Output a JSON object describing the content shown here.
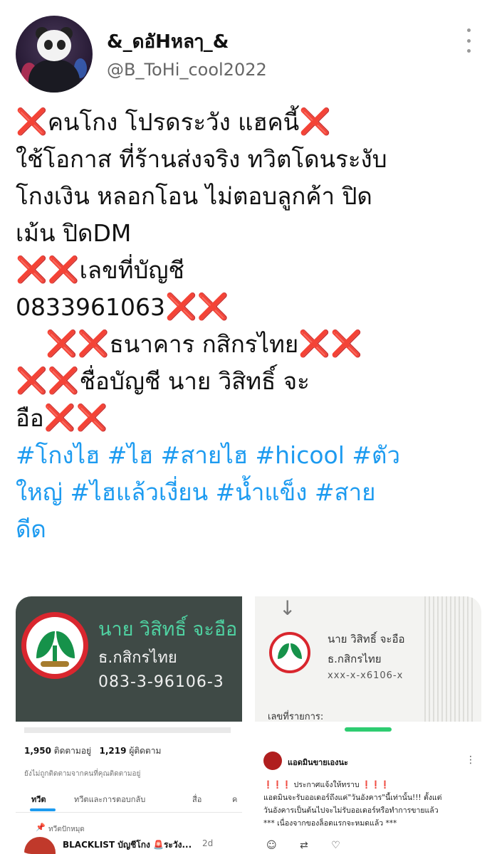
{
  "user": {
    "display_name": "&_ดอัHหลๅ_&",
    "handle": "@B_ToHi_cool2022"
  },
  "tweet": {
    "lines": [
      {
        "pre": "❌",
        "text": "คนโกง โปรดระวัง แฮคนี้",
        "post": "❌"
      },
      {
        "pre": "",
        "text": "ใช้โอกาส ที่ร้านส่งจริง ทวิตโดนระงับ",
        "post": ""
      },
      {
        "pre": "",
        "text": "โกงเงิน  หลอกโอน  ไม่ตอบลูกค้า ปิด",
        "post": ""
      },
      {
        "pre": "",
        "text": "เม้น ปิดDM",
        "post": ""
      },
      {
        "pre": "❌❌",
        "text": "เลขที่บัญชี",
        "post": ""
      },
      {
        "pre": "",
        "text": "0833961063",
        "post": "❌❌"
      },
      {
        "pre": "❌❌",
        "text": "ธนาคาร  กสิกรไทย",
        "post": "❌❌"
      },
      {
        "pre": "❌❌",
        "text": "ชื่อบัญชี  นาย วิสิทธิ์ จะ",
        "post": ""
      },
      {
        "pre": "",
        "text": "อือ",
        "post": "❌❌"
      }
    ],
    "hashtag_lines": [
      "#โกงไฮ #ไฮ #สายไฮ #hicool #ตัว",
      "ใหญ่ #ไฮแล้วเงี่ยน #น้ำแข็ง #สาย",
      "ดีด"
    ]
  },
  "media": {
    "card": {
      "name": "นาย วิสิทธิ์ จะอือ",
      "bank": "ธ.กสิกรไทย",
      "account": "083-3-96106-3"
    },
    "slip": {
      "arrow": "↓",
      "name": "นาย วิสิทธิ์ จะอือ",
      "bank": "ธ.กสิกรไทย",
      "account": "xxx-x-x6106-x",
      "ref_label": "เลขที่รายการ:"
    },
    "profile": {
      "following_count": "1,950",
      "following_label": "ติดตามอยู่",
      "followers_count": "1,219",
      "followers_label": "ผู้ติดตาม",
      "not_followed": "ยังไม่ถูกติดตามจากคนที่คุณติดตามอยู่",
      "tabs": [
        "ทวีต",
        "ทวีตและการตอบกลับ",
        "สื่อ",
        "ค"
      ],
      "pinned_label": "ทวีตปักหมุด",
      "pinned_title": "BLACKLIST บัญชีโกง 🚨ระวัง...",
      "pinned_time": "2d"
    },
    "admin_post": {
      "name": "แอดมินขายเองนะ",
      "line1_marks": "❗❗❗",
      "line1_text": "ประกาศแจ้งให้ทราบ",
      "line1_end": "❗❗❗",
      "line2": "แอดมินจะรับออเดอร์ถึงแค่\"วันอังคาร\"นี้เท่านั้น!!! ตั้งแต่",
      "line3": "วันอังคารเป็นต้นไปจะไม่รับออเดอร์หรือทำการขายแล้ว",
      "line4": "*** เนื่องจากของล็อตแรกจะหมดแล้ว ***",
      "icons": "☺ ⇄ ♡"
    }
  }
}
